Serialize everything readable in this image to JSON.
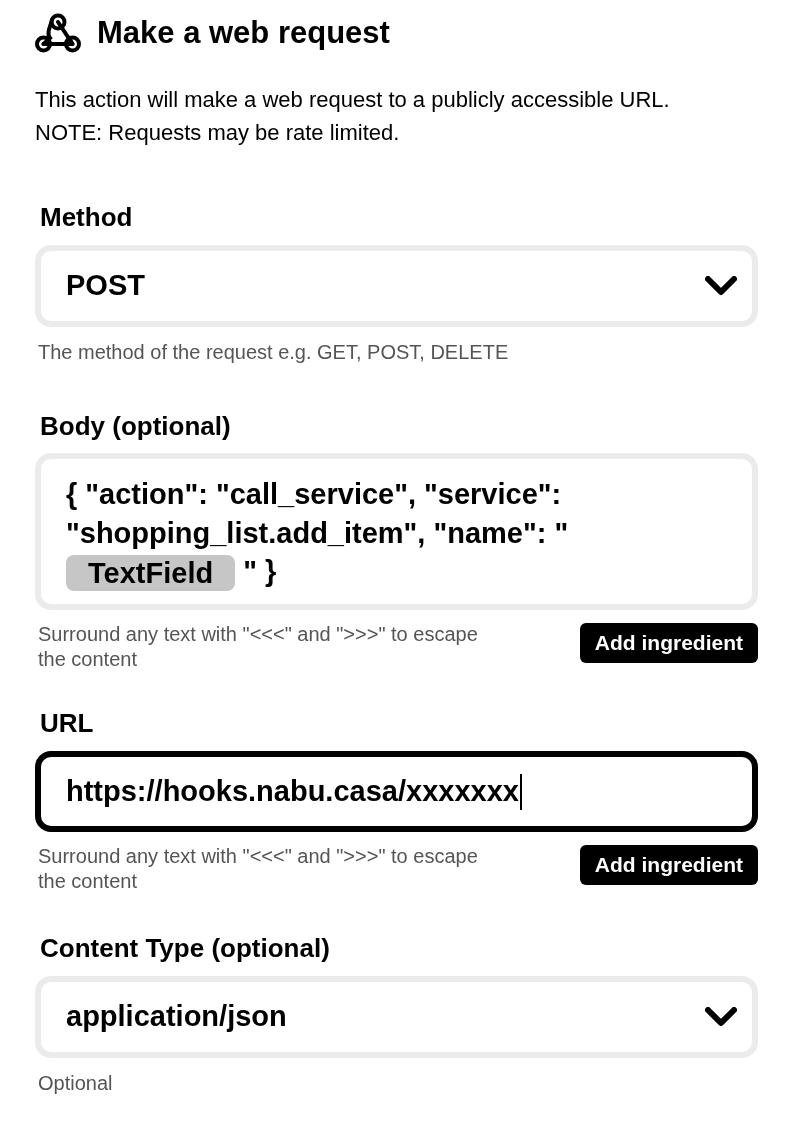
{
  "header": {
    "title": "Make a web request",
    "description": "This action will make a web request to a publicly accessible URL. NOTE: Requests may be rate limited."
  },
  "fields": [
    {
      "kind": "select",
      "label": "Method",
      "value": "POST",
      "help": "The method of the request e.g. GET, POST, DELETE"
    },
    {
      "kind": "textarea",
      "label": "Body (optional)",
      "value_parts": [
        {
          "kind": "text",
          "text": "{ \"action\": \"call_service\", \"service\": \"shopping_list.add_item\", \"name\": \""
        },
        {
          "kind": "ingredient",
          "text": "TextField"
        },
        {
          "kind": "text",
          "text": " \" }"
        }
      ],
      "help": "Surround any text with \"<<<\" and \">>>\" to escape the content",
      "button": "Add ingredient"
    },
    {
      "kind": "text",
      "label": "URL",
      "value": "https://hooks.nabu.casa/xxxxxxx",
      "focused": true,
      "help": "Surround any text with \"<<<\" and \">>>\" to escape the content",
      "button": "Add ingredient"
    },
    {
      "kind": "select",
      "label": "Content Type (optional)",
      "value": "application/json",
      "help": "Optional"
    }
  ]
}
